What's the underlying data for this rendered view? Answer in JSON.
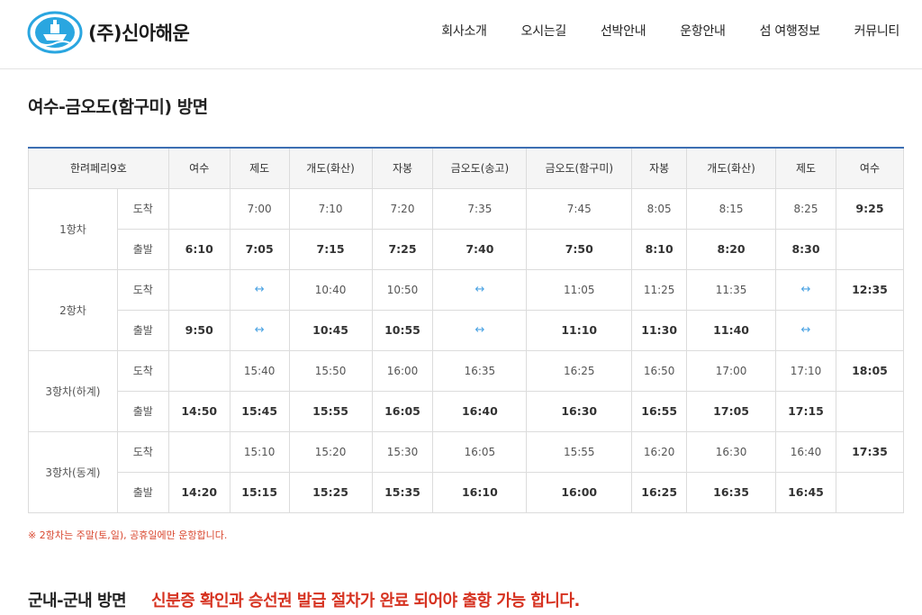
{
  "header": {
    "logo_text": "(주)신아해운",
    "nav": [
      "회사소개",
      "오시는길",
      "선박안내",
      "운항안내",
      "섬 여행정보",
      "커뮤니티"
    ]
  },
  "page": {
    "title": "여수-금오도(함구미) 방면"
  },
  "timetable": {
    "headers": [
      "한려페리9호",
      "여수",
      "제도",
      "개도(화산)",
      "자봉",
      "금오도(송고)",
      "금오도(함구미)",
      "자봉",
      "개도(화산)",
      "제도",
      "여수"
    ],
    "trips": [
      {
        "name": "1항차",
        "rows": [
          {
            "type": "도착",
            "cells": [
              "",
              "7:00",
              "7:10",
              "7:20",
              "7:35",
              "7:45",
              "8:05",
              "8:15",
              "8:25",
              "9:25"
            ]
          },
          {
            "type": "출발",
            "cells": [
              "6:10",
              "7:05",
              "7:15",
              "7:25",
              "7:40",
              "7:50",
              "8:10",
              "8:20",
              "8:30",
              ""
            ]
          }
        ]
      },
      {
        "name": "2항차",
        "rows": [
          {
            "type": "도착",
            "cells": [
              "",
              "↔",
              "10:40",
              "10:50",
              "↔",
              "11:05",
              "11:25",
              "11:35",
              "↔",
              "12:35"
            ]
          },
          {
            "type": "출발",
            "cells": [
              "9:50",
              "↔",
              "10:45",
              "10:55",
              "↔",
              "11:10",
              "11:30",
              "11:40",
              "↔",
              ""
            ]
          }
        ]
      },
      {
        "name": "3항차(하계)",
        "rows": [
          {
            "type": "도착",
            "cells": [
              "",
              "15:40",
              "15:50",
              "16:00",
              "16:35",
              "16:25",
              "16:50",
              "17:00",
              "17:10",
              "18:05"
            ]
          },
          {
            "type": "출발",
            "cells": [
              "14:50",
              "15:45",
              "15:55",
              "16:05",
              "16:40",
              "16:30",
              "16:55",
              "17:05",
              "17:15",
              ""
            ]
          }
        ]
      },
      {
        "name": "3항차(동계)",
        "rows": [
          {
            "type": "도착",
            "cells": [
              "",
              "15:10",
              "15:20",
              "15:30",
              "16:05",
              "15:55",
              "16:20",
              "16:30",
              "16:40",
              "17:35"
            ]
          },
          {
            "type": "출발",
            "cells": [
              "14:20",
              "15:15",
              "15:25",
              "15:35",
              "16:10",
              "16:00",
              "16:25",
              "16:35",
              "16:45",
              ""
            ]
          }
        ]
      }
    ]
  },
  "note": "※ 2항차는 주말(토,일), 공휴일에만 운항합니다.",
  "next_section": {
    "title": "군내-군내 방면",
    "warning": "신분증 확인과 승선권 발급 절차가 완료 되어야 출항 가능 합니다."
  },
  "colors": {
    "accent": "#3d6fb3",
    "warning": "#d63220",
    "arrow": "#4ba3e3"
  }
}
